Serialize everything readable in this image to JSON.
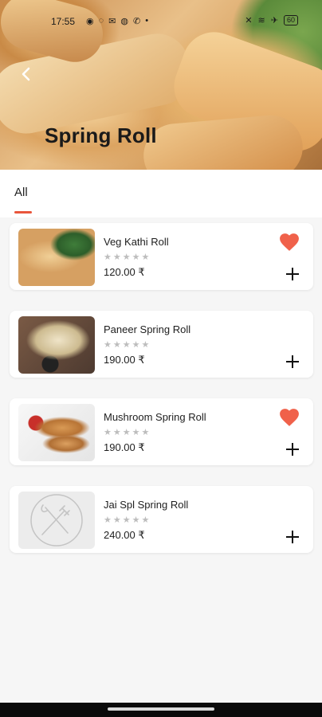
{
  "status_bar": {
    "time": "17:55",
    "battery": "60"
  },
  "header": {
    "title": "Spring Roll"
  },
  "tabs": [
    {
      "label": "All",
      "active": true
    }
  ],
  "accent_color": "#e9553b",
  "items": [
    {
      "name": "Veg Kathi Roll",
      "rating_stars": "★★★★★",
      "price": "120.00 ₹",
      "favorite": true
    },
    {
      "name": "Paneer Spring Roll",
      "rating_stars": "★★★★★",
      "price": "190.00 ₹",
      "favorite": false
    },
    {
      "name": "Mushroom Spring Roll",
      "rating_stars": "★★★★★",
      "price": "190.00 ₹",
      "favorite": true
    },
    {
      "name": "Jai Spl Spring Roll",
      "rating_stars": "★★★★★",
      "price": "240.00 ₹",
      "favorite": false
    }
  ]
}
